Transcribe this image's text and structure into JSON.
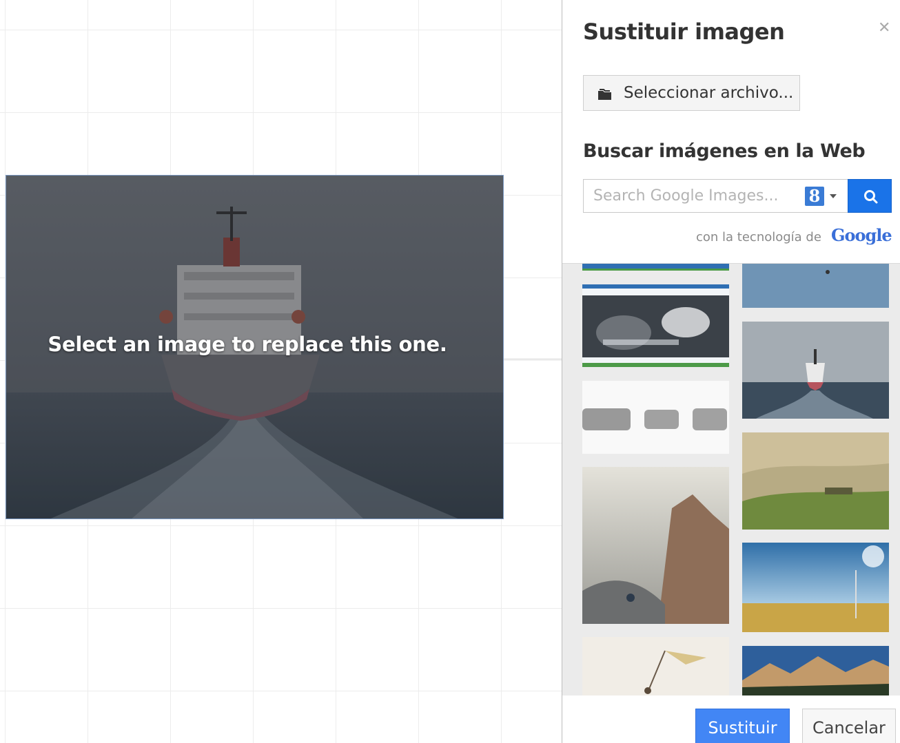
{
  "canvas": {
    "caption": "Select an image to replace this one."
  },
  "panel": {
    "title": "Sustituir imagen",
    "close_icon": "close-icon",
    "file_button_label": "Seleccionar archivo...",
    "file_button_icon": "folder-icon",
    "search_heading": "Buscar imágenes en la Web",
    "search": {
      "placeholder": "Search Google Images...",
      "value": "",
      "engine_badge": "8",
      "button_icon": "search-icon"
    },
    "powered_by": {
      "text": "con la tecnología de",
      "brand": "Google"
    },
    "results": {
      "thumbnails": [
        "website-screenshot",
        "sky-top",
        "blurred-text",
        "ship-at-sea",
        "tuscany-hills",
        "rock-climber",
        "meadow-and-sky",
        "flag-on-pole",
        "mountain-range"
      ]
    },
    "footer": {
      "primary_label": "Sustituir",
      "secondary_label": "Cancelar"
    }
  },
  "colors": {
    "primary_button": "#4286f5",
    "search_button": "#1a73e8",
    "google_blue": "#3a7bd5"
  }
}
